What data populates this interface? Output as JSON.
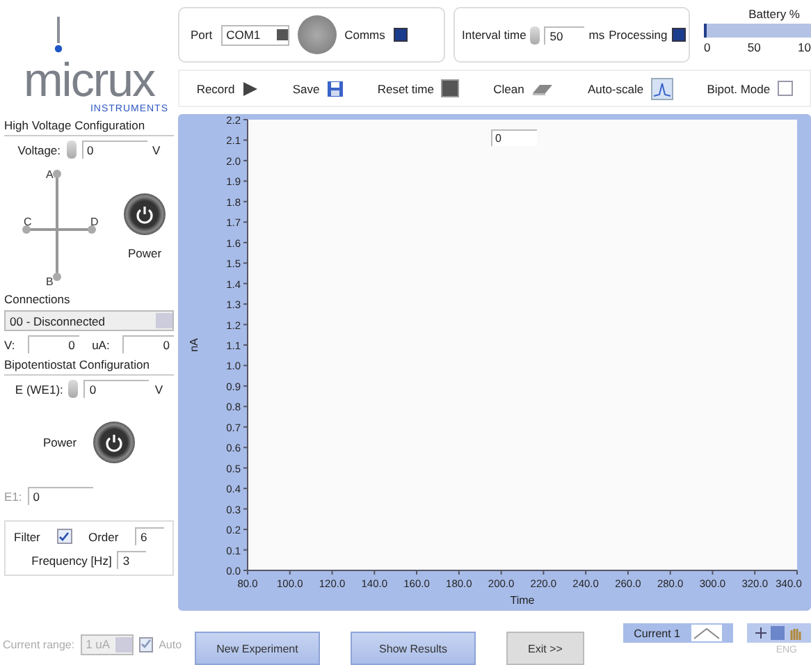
{
  "logo": {
    "name": "micrux",
    "subtitle": "INSTRUMENTS"
  },
  "port": {
    "label": "Port",
    "value": "COM1"
  },
  "comms": {
    "label": "Comms",
    "on": false
  },
  "interval": {
    "label": "Interval time",
    "value": "50",
    "unit": "ms"
  },
  "processing": {
    "label": "Processing",
    "on": false
  },
  "battery": {
    "label": "Battery %",
    "level": 0.02,
    "ticks": [
      "0",
      "50",
      "10"
    ]
  },
  "toolbar": [
    {
      "label": "Record",
      "kind": "play"
    },
    {
      "label": "Save",
      "kind": "save"
    },
    {
      "label": "Reset time",
      "kind": "stop"
    },
    {
      "label": "Clean",
      "kind": "clean"
    },
    {
      "label": "Auto-scale",
      "kind": "autoscale"
    },
    {
      "label": "Bipot. Mode",
      "kind": "checkbox",
      "checked": false
    }
  ],
  "high_voltage": {
    "title": "High Voltage Configuration",
    "voltage": {
      "label": "Voltage:",
      "value": "0",
      "unit": "V"
    },
    "electrodes": [
      "A",
      "C",
      "D",
      "B"
    ],
    "power_label": "Power",
    "connections_label": "Connections",
    "connections_value": "00 - Disconnected",
    "v_reading": {
      "label": "V:",
      "value": "0"
    },
    "ua_reading": {
      "label": "uA:",
      "value": "0"
    }
  },
  "bipotentiostat": {
    "title": "Bipotentiostat Configuration",
    "e_we1": {
      "label": "E (WE1):",
      "value": "0",
      "unit": "V"
    },
    "power_label": "Power",
    "e1": {
      "label": "E1:",
      "value": "0"
    }
  },
  "filter": {
    "label": "Filter",
    "checked": true,
    "order": {
      "label": "Order",
      "value": "6"
    },
    "frequency": {
      "label": "Frequency [Hz]",
      "value": "3"
    }
  },
  "current_range": {
    "label": "Current range:",
    "value": "1 uA",
    "disabled": true,
    "auto": {
      "label": "Auto",
      "checked": true
    }
  },
  "chart": {
    "readout": "0",
    "chart_data": {
      "type": "line",
      "xlabel": "Time",
      "ylabel": "nA",
      "xlim": [
        80,
        340
      ],
      "ylim": [
        0,
        2.2
      ],
      "xticks": [
        {
          "value": 80,
          "label": "80.0"
        },
        {
          "value": 100,
          "label": "100.0"
        },
        {
          "value": 120,
          "label": "120.0"
        },
        {
          "value": 140,
          "label": "140.0"
        },
        {
          "value": 160,
          "label": "160.0"
        },
        {
          "value": 180,
          "label": "180.0"
        },
        {
          "value": 200,
          "label": "200.0"
        },
        {
          "value": 220,
          "label": "220.0"
        },
        {
          "value": 240,
          "label": "240.0"
        },
        {
          "value": 260,
          "label": "260.0"
        },
        {
          "value": 280,
          "label": "280.0"
        },
        {
          "value": 300,
          "label": "300.0"
        },
        {
          "value": 320,
          "label": "320.0"
        },
        {
          "value": 340,
          "label": "340.0"
        }
      ],
      "yticks": [
        {
          "value": 0,
          "label": "0.0"
        },
        {
          "value": 0.1,
          "label": "0.1"
        },
        {
          "value": 0.2,
          "label": "0.2"
        },
        {
          "value": 0.3,
          "label": "0.3"
        },
        {
          "value": 0.4,
          "label": "0.4"
        },
        {
          "value": 0.5,
          "label": "0.5"
        },
        {
          "value": 0.6,
          "label": "0.6"
        },
        {
          "value": 0.7,
          "label": "0.7"
        },
        {
          "value": 0.8,
          "label": "0.8"
        },
        {
          "value": 0.9,
          "label": "0.9"
        },
        {
          "value": 1.0,
          "label": "1.0"
        },
        {
          "value": 1.1,
          "label": "1.1"
        },
        {
          "value": 1.2,
          "label": "1.2"
        },
        {
          "value": 1.3,
          "label": "1.3"
        },
        {
          "value": 1.4,
          "label": "1.4"
        },
        {
          "value": 1.5,
          "label": "1.5"
        },
        {
          "value": 1.6,
          "label": "1.6"
        },
        {
          "value": 1.7,
          "label": "1.7"
        },
        {
          "value": 1.8,
          "label": "1.8"
        },
        {
          "value": 1.9,
          "label": "1.9"
        },
        {
          "value": 2.0,
          "label": "2.0"
        },
        {
          "value": 2.1,
          "label": "2.1"
        },
        {
          "value": 2.2,
          "label": "2.2"
        }
      ]
    }
  },
  "legend": {
    "label": "Current 1"
  },
  "buttons": [
    {
      "label": "New Experiment",
      "kind": "primary"
    },
    {
      "label": "Show Results",
      "kind": "primary"
    },
    {
      "label": "Exit >>",
      "kind": "secondary"
    }
  ],
  "status": "ENG"
}
